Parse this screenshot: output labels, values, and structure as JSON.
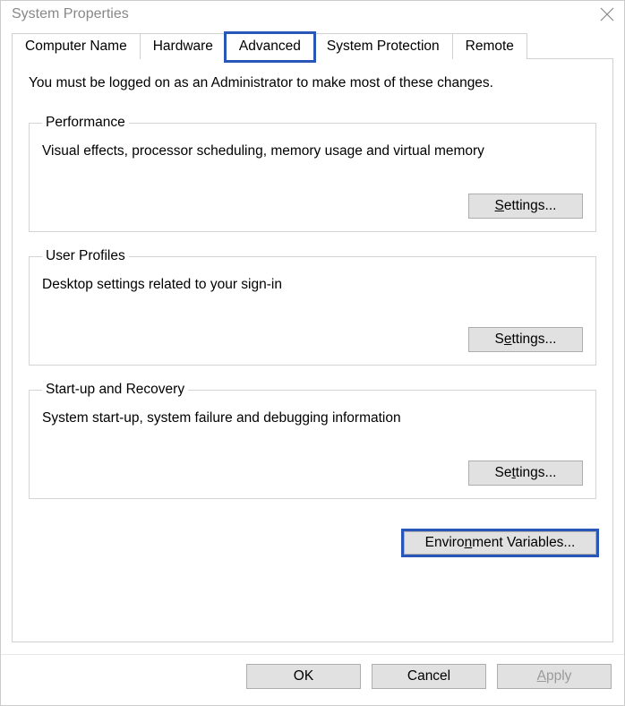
{
  "window": {
    "title": "System Properties"
  },
  "tabs": {
    "items": [
      {
        "label": "Computer Name"
      },
      {
        "label": "Hardware"
      },
      {
        "label": "Advanced"
      },
      {
        "label": "System Protection"
      },
      {
        "label": "Remote"
      }
    ],
    "active_index": 2,
    "highlighted_index": 2
  },
  "intro": "You must be logged on as an Administrator to make most of these changes.",
  "groups": {
    "performance": {
      "legend": "Performance",
      "desc": "Visual effects, processor scheduling, memory usage and virtual memory",
      "button_prefix": "",
      "button_accel": "S",
      "button_suffix": "ettings..."
    },
    "user_profiles": {
      "legend": "User Profiles",
      "desc": "Desktop settings related to your sign-in",
      "button_prefix": "S",
      "button_accel": "e",
      "button_suffix": "ttings..."
    },
    "startup": {
      "legend": "Start-up and Recovery",
      "desc": "System start-up, system failure and debugging information",
      "button_prefix": "Se",
      "button_accel": "t",
      "button_suffix": "tings..."
    }
  },
  "env_button": {
    "prefix": "Enviro",
    "accel": "n",
    "suffix": "ment Variables..."
  },
  "dialog_buttons": {
    "ok": "OK",
    "cancel": "Cancel",
    "apply_prefix": "",
    "apply_accel": "A",
    "apply_suffix": "pply"
  },
  "colors": {
    "highlight": "#2857b8"
  }
}
